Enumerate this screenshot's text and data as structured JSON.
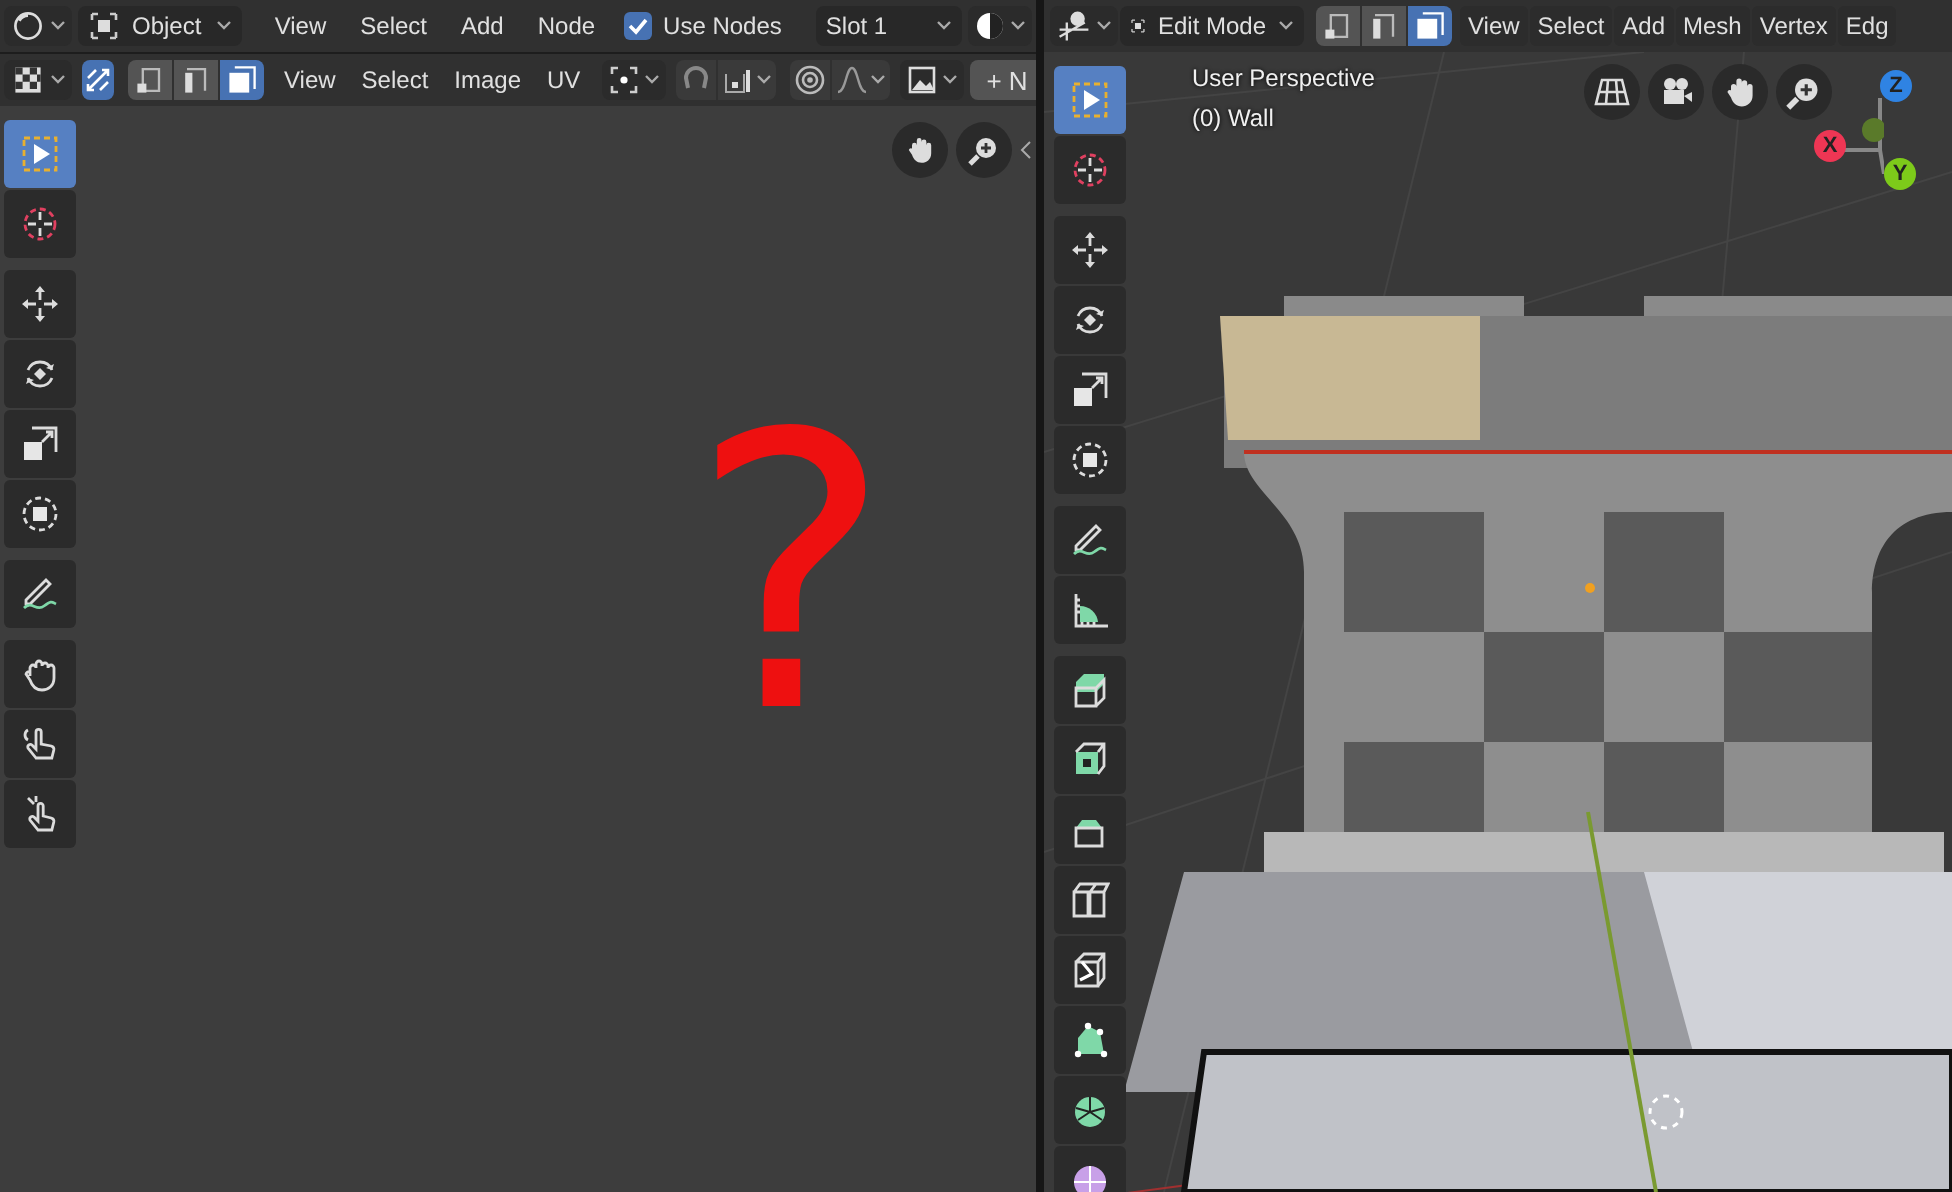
{
  "uv_editor": {
    "header": {
      "mode": "Object",
      "menus": [
        "View",
        "Select",
        "Add",
        "Node"
      ],
      "use_nodes": {
        "label": "Use Nodes",
        "checked": true
      },
      "slot": "Slot 1"
    },
    "tool_header": {
      "sync_selection": true,
      "select_modes": [
        {
          "kind": "vertex",
          "selected": false
        },
        {
          "kind": "edge",
          "selected": false
        },
        {
          "kind": "face",
          "selected": true
        }
      ],
      "menus": [
        "View",
        "Select",
        "Image",
        "UV"
      ],
      "new_button": "+ N"
    },
    "tools": [
      [
        {
          "kind": "select",
          "selected": true
        },
        {
          "kind": "cursor",
          "selected": false
        }
      ],
      [
        {
          "kind": "move",
          "selected": false
        },
        {
          "kind": "rotate",
          "selected": false
        },
        {
          "kind": "scale",
          "selected": false
        },
        {
          "kind": "transform",
          "selected": false
        }
      ],
      [
        {
          "kind": "annotate",
          "selected": false
        }
      ],
      [
        {
          "kind": "grab",
          "selected": false
        },
        {
          "kind": "relax",
          "selected": false
        },
        {
          "kind": "pinch",
          "selected": false
        }
      ]
    ],
    "annotation": "?"
  },
  "viewport": {
    "header": {
      "mode": "Edit Mode",
      "select_modes": [
        {
          "kind": "vertex",
          "selected": false
        },
        {
          "kind": "edge",
          "selected": false
        },
        {
          "kind": "face",
          "selected": true
        }
      ],
      "menus": [
        "View",
        "Select",
        "Add",
        "Mesh",
        "Vertex",
        "Edg"
      ]
    },
    "view_name": "User Perspective",
    "object_name": "(0) Wall",
    "axes": [
      {
        "label": "Z",
        "color": "#2f83e3"
      },
      {
        "label": "X",
        "color": "#ee3654"
      },
      {
        "label": "Y",
        "color": "#7dca1a"
      }
    ],
    "tools": [
      [
        {
          "kind": "select",
          "selected": true
        },
        {
          "kind": "cursor",
          "selected": false
        }
      ],
      [
        {
          "kind": "move",
          "selected": false
        },
        {
          "kind": "rotate",
          "selected": false
        },
        {
          "kind": "scale",
          "selected": false
        },
        {
          "kind": "transform",
          "selected": false
        }
      ],
      [
        {
          "kind": "annotate",
          "selected": false
        },
        {
          "kind": "measure",
          "selected": false
        }
      ],
      [
        {
          "kind": "extrude",
          "selected": false
        },
        {
          "kind": "inset",
          "selected": false
        },
        {
          "kind": "bevel",
          "selected": false
        },
        {
          "kind": "loopcut",
          "selected": false
        },
        {
          "kind": "knife",
          "selected": false
        },
        {
          "kind": "polybuild",
          "selected": false
        },
        {
          "kind": "spin",
          "selected": false
        },
        {
          "kind": "sphere",
          "selected": false
        }
      ]
    ]
  }
}
